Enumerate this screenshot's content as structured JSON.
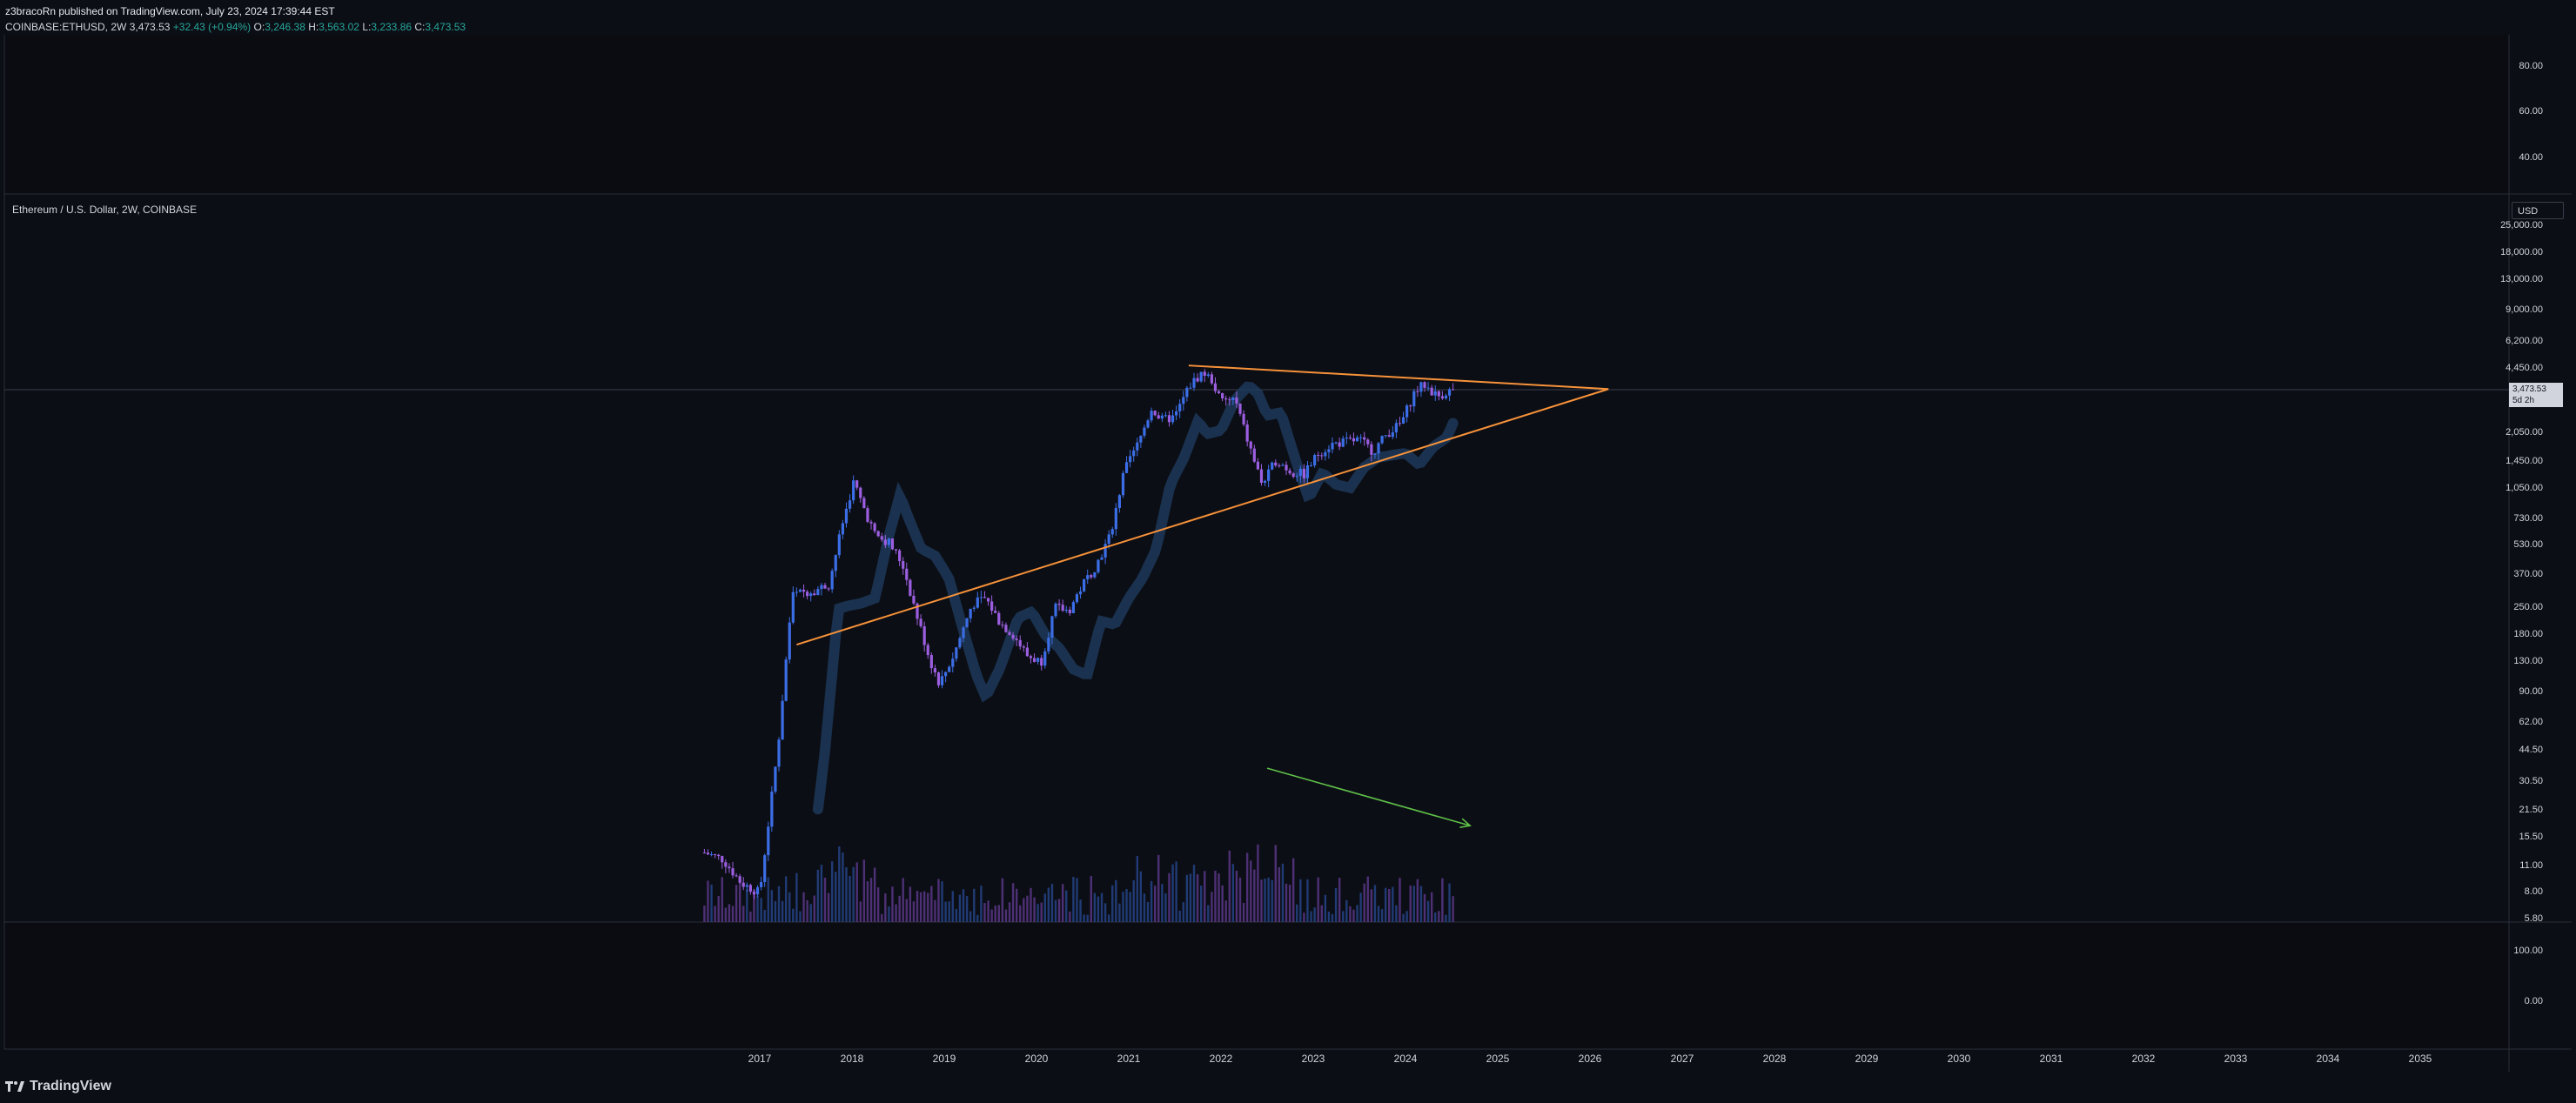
{
  "header": {
    "published": "z3bracoRn published on TradingView.com, July 23, 2024 17:39:44 EST",
    "symbol": "COINBASE:ETHUSD, 2W",
    "last": "3,473.53",
    "change": "+32.43 (+0.94%)",
    "o_key": "O:",
    "o": "3,246.38",
    "h_key": "H:",
    "h": "3,563.02",
    "l_key": "L:",
    "l": "3,233.86",
    "c_key": "C:",
    "c": "3,473.53"
  },
  "pane_label": "Ethereum / U.S. Dollar, 2W, COINBASE",
  "currency_button": "USD",
  "price_tag": {
    "price": "3,473.53",
    "countdown": "5d 2h"
  },
  "top_pane_axis": [
    "80.00",
    "60.00",
    "40.00"
  ],
  "bottom_pane_axis": [
    "100.00",
    "0.00"
  ],
  "footer": {
    "brand": "TradingView"
  },
  "colors": {
    "background": "#0c0e15",
    "candle_up": "#3b6ee6",
    "candle_down": "#9c5ee0",
    "trendline": "#f7923a",
    "volume_arrow": "#5fbf48",
    "ma_band": "#1e3c5e",
    "change_text": "#26a69a"
  },
  "chart_data": {
    "type": "candlestick",
    "title": "Ethereum / U.S. Dollar, 2W, COINBASE",
    "y_scale": "log",
    "y_ticks": [
      "25,000.00",
      "18,000.00",
      "13,000.00",
      "9,000.00",
      "6,200.00",
      "4,450.00",
      "2,050.00",
      "1,450.00",
      "1,050.00",
      "730.00",
      "530.00",
      "370.00",
      "250.00",
      "180.00",
      "130.00",
      "90.00",
      "62.00",
      "44.50",
      "30.50",
      "21.50",
      "15.50",
      "11.00",
      "8.00",
      "5.80"
    ],
    "x_ticks": [
      "2017",
      "2018",
      "2019",
      "2020",
      "2021",
      "2022",
      "2023",
      "2024",
      "2025",
      "2026",
      "2027",
      "2028",
      "2029",
      "2030",
      "2031",
      "2032",
      "2033",
      "2034",
      "2035"
    ],
    "close_series": {
      "x": [
        2016.4,
        2016.6,
        2016.8,
        2017.0,
        2017.2,
        2017.35,
        2017.45,
        2017.6,
        2017.75,
        2017.9,
        2018.02,
        2018.1,
        2018.25,
        2018.4,
        2018.55,
        2018.7,
        2018.85,
        2018.95,
        2019.1,
        2019.3,
        2019.45,
        2019.6,
        2019.75,
        2019.9,
        2020.05,
        2020.2,
        2020.35,
        2020.5,
        2020.65,
        2020.8,
        2020.95,
        2021.1,
        2021.25,
        2021.35,
        2021.5,
        2021.65,
        2021.8,
        2021.9,
        2022.0,
        2022.15,
        2022.3,
        2022.45,
        2022.6,
        2022.75,
        2022.9,
        2023.05,
        2023.2,
        2023.35,
        2023.5,
        2023.65,
        2023.8,
        2023.95,
        2024.1,
        2024.2,
        2024.35,
        2024.45,
        2024.55
      ],
      "y": [
        13,
        12,
        9,
        8,
        48,
        290,
        300,
        310,
        330,
        700,
        1150,
        900,
        600,
        550,
        420,
        230,
        130,
        100,
        140,
        260,
        280,
        210,
        180,
        140,
        130,
        250,
        240,
        330,
        420,
        600,
        1300,
        1800,
        2800,
        2400,
        2500,
        3600,
        4300,
        3900,
        3000,
        3100,
        1800,
        1100,
        1500,
        1300,
        1250,
        1600,
        1800,
        1850,
        1900,
        1650,
        2050,
        2300,
        3400,
        3700,
        3200,
        3400,
        3473.53
      ]
    },
    "trendlines": [
      {
        "from": [
          2021.65,
          4650
        ],
        "to": [
          2026.2,
          3500
        ]
      },
      {
        "from": [
          2017.4,
          160
        ],
        "to": [
          2026.2,
          3500
        ]
      }
    ],
    "volume_arrow": {
      "from": [
        2022.5,
        36
      ],
      "to": [
        2024.7,
        18
      ]
    },
    "current_price": 3473.53
  }
}
